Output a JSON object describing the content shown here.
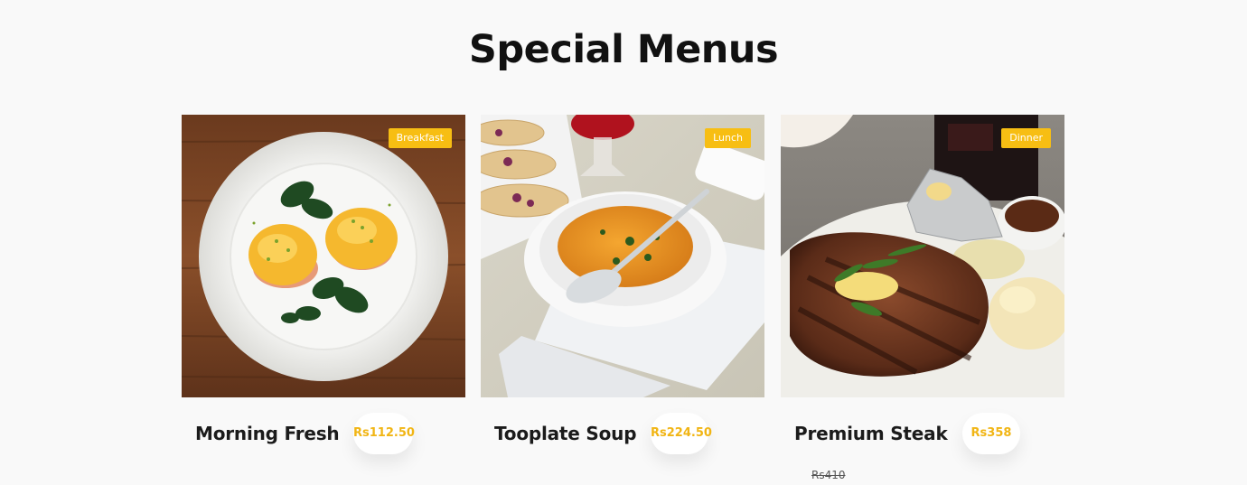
{
  "section": {
    "title": "Special Menus"
  },
  "menus": [
    {
      "name": "Morning Fresh",
      "price": "Rs112.50",
      "category": "Breakfast",
      "image": "eggs-benedict-plate"
    },
    {
      "name": "Tooplate Soup",
      "price": "Rs224.50",
      "category": "Lunch",
      "image": "soup-bowl-with-spoon"
    },
    {
      "name": "Premium Steak",
      "price": "Rs358",
      "old_price": "Rs410",
      "category": "Dinner",
      "image": "steak-plate"
    }
  ],
  "colors": {
    "accent": "#f7be13",
    "price_text": "#f1b514",
    "background": "#f9f9f9"
  }
}
